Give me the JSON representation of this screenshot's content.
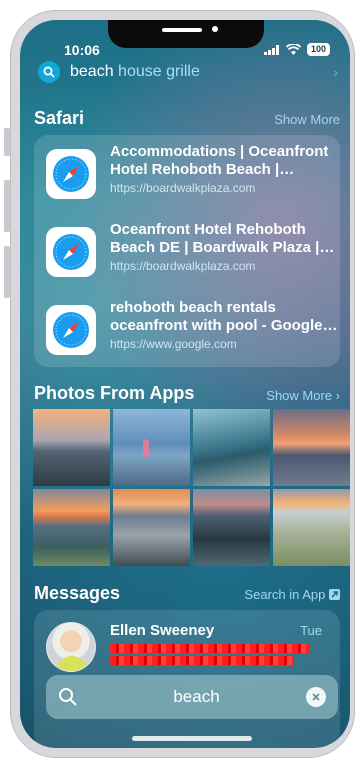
{
  "status_bar": {
    "time": "10:06",
    "battery": "100"
  },
  "top_search": {
    "typed": "beach",
    "completion": " house grille"
  },
  "safari": {
    "title": "Safari",
    "show_more": "Show More",
    "results": [
      {
        "title": "Accommodations | Oceanfront Hotel Rehoboth Beach | Boardwalk Plaza",
        "url": "https://boardwalkplaza.com"
      },
      {
        "title": "Oceanfront Hotel Rehoboth Beach DE | Boardwalk Plaza | Rehoboth Beach",
        "url": "https://boardwalkplaza.com"
      },
      {
        "title": "rehoboth beach rentals oceanfront with pool - Google Search",
        "url": "https://www.google.com"
      }
    ]
  },
  "photos": {
    "title": "Photos From Apps",
    "show_more": "Show More"
  },
  "messages": {
    "title": "Messages",
    "search_in_app": "Search in App",
    "sender": "Ellen Sweeney",
    "date": "Tue"
  },
  "bottom_search": {
    "value": "beach"
  },
  "colors": {
    "accent": "#13a6d8",
    "link": "#9fd8ee",
    "redaction": "#ff1e1e"
  },
  "icons": {
    "search": "search-icon",
    "safari": "safari-compass-icon",
    "clear": "clear-icon",
    "chevron": "chevron-right-icon"
  }
}
